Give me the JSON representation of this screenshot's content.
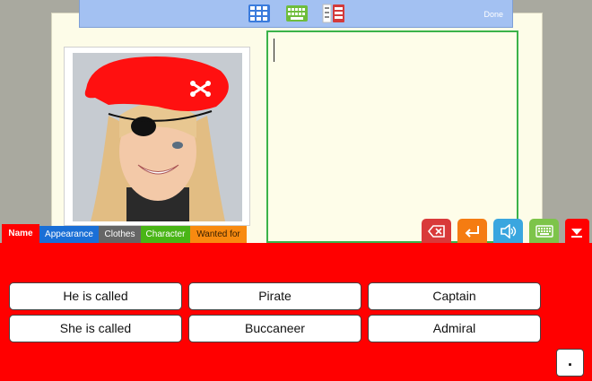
{
  "toolbar": {
    "done_label": "Done",
    "icons": [
      "grid-icon",
      "keyboard-icon",
      "list-icon"
    ],
    "accent": "#a3c1f2"
  },
  "photo": {
    "icon": "pirate-girl-photo"
  },
  "text_area": {
    "value": ""
  },
  "actions": [
    {
      "name": "backspace-icon",
      "color": "#d93a3a"
    },
    {
      "name": "enter-icon",
      "color": "#f57c12"
    },
    {
      "name": "speak-icon",
      "color": "#3aa6df"
    },
    {
      "name": "keyboard-icon",
      "color": "#7dc44a"
    },
    {
      "name": "collapse-icon",
      "color": "#ff0000"
    }
  ],
  "tabs": [
    {
      "label": "Name",
      "bg": "#ff0000",
      "fg": "#ffffff",
      "active": true
    },
    {
      "label": "Appearance",
      "bg": "#1a6fd6",
      "fg": "#ffffff"
    },
    {
      "label": "Clothes",
      "bg": "#666666",
      "fg": "#ffffff"
    },
    {
      "label": "Character",
      "bg": "#49b516",
      "fg": "#ffffff"
    },
    {
      "label": "Wanted for",
      "bg": "#f88a10",
      "fg": "#3a2000"
    }
  ],
  "words": {
    "row1": [
      "He is called",
      "Pirate",
      "Captain"
    ],
    "row2": [
      "She is called",
      "Buccaneer",
      "Admiral"
    ]
  },
  "punctuation": "."
}
